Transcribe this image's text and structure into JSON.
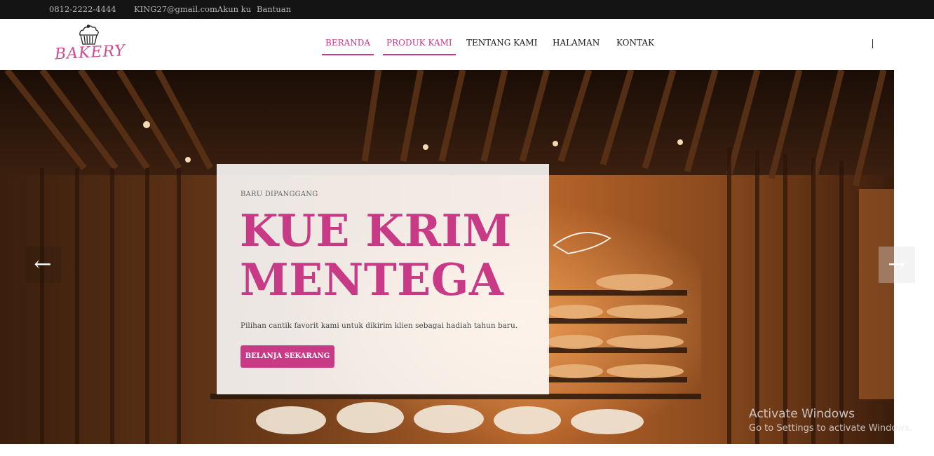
{
  "topbar": {
    "phone": "0812-2222-4444",
    "email_account": "KING27@gmail.comAkun ku",
    "help": "Bantuan"
  },
  "logo": {
    "text": "BAKERY",
    "icon": "cupcake-icon"
  },
  "nav": {
    "items": [
      {
        "label": "BERANDA",
        "active": true
      },
      {
        "label": "PRODUK KAMI",
        "active": true
      },
      {
        "label": "TENTANG KAMI",
        "active": false
      },
      {
        "label": "HALAMAN",
        "active": false
      },
      {
        "label": "KONTAK",
        "active": false
      }
    ]
  },
  "hero": {
    "kicker": "BARU DIPANGGANG",
    "title_line1": "KUE KRIM",
    "title_line2": "MENTEGA",
    "description": "Pilihan cantik favorit kami untuk dikirim klien sebagai hadiah tahun baru.",
    "button_label": "BELANJA SEKARANG",
    "prev_arrow": "←",
    "next_arrow": "→"
  },
  "watermark": {
    "title": "Activate Windows",
    "subtitle": "Go to Settings to activate Windows."
  },
  "colors": {
    "accent": "#c93a86",
    "topbar": "#141414"
  }
}
